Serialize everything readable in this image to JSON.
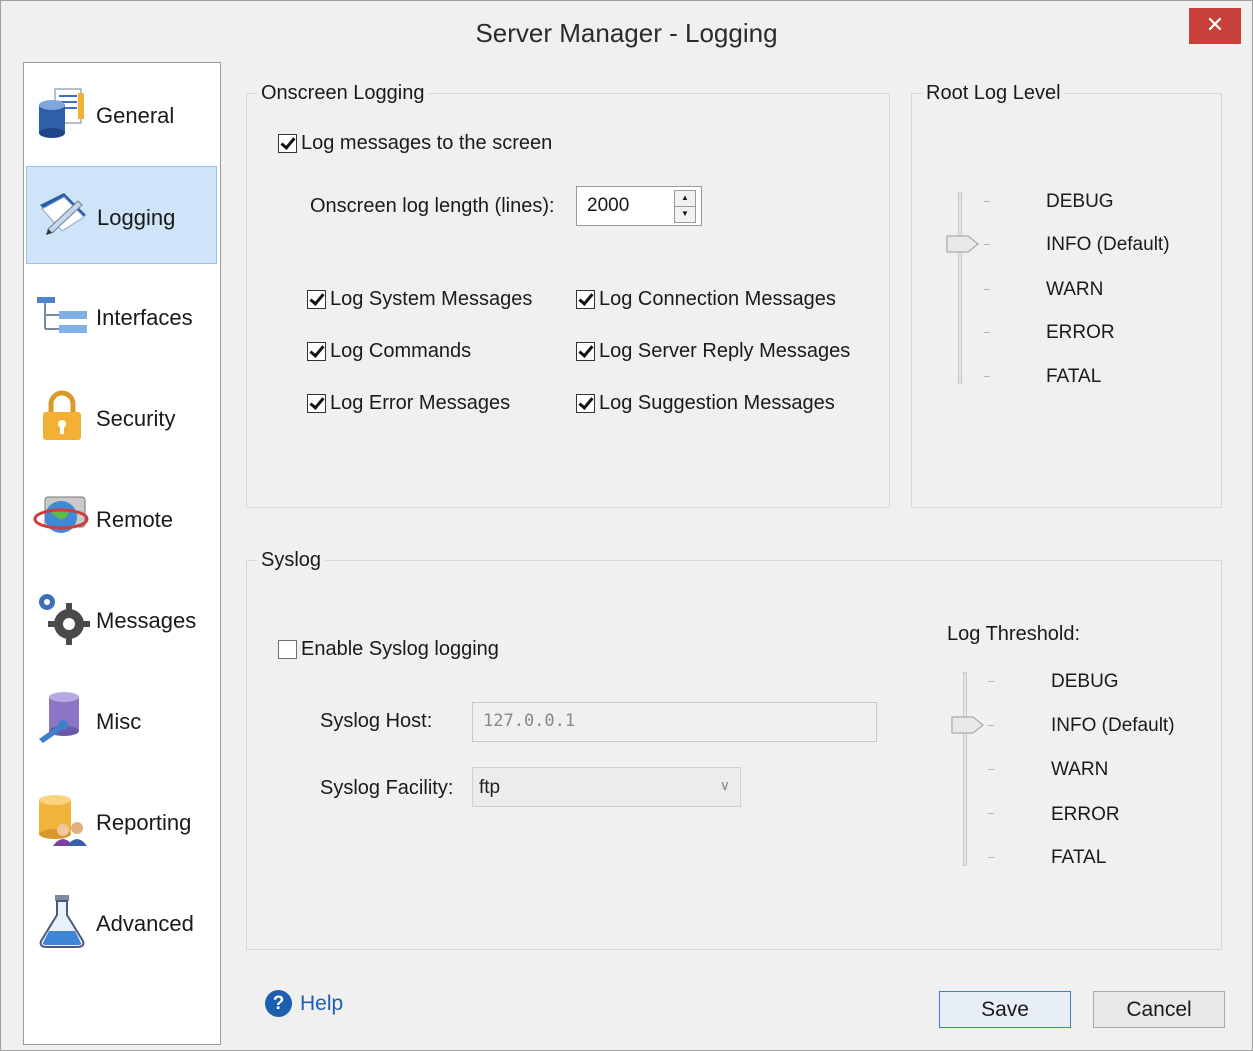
{
  "window": {
    "title": "Server Manager - Logging",
    "close_glyph": "✕"
  },
  "sidebar": {
    "items": [
      {
        "label": "General",
        "icon": "database-document-icon",
        "selected": false
      },
      {
        "label": "Logging",
        "icon": "logbook-pen-icon",
        "selected": true
      },
      {
        "label": "Interfaces",
        "icon": "network-tree-icon",
        "selected": false
      },
      {
        "label": "Security",
        "icon": "padlock-icon",
        "selected": false
      },
      {
        "label": "Remote",
        "icon": "globe-monitor-icon",
        "selected": false
      },
      {
        "label": "Messages",
        "icon": "gears-icon",
        "selected": false
      },
      {
        "label": "Misc",
        "icon": "database-wrench-icon",
        "selected": false
      },
      {
        "label": "Reporting",
        "icon": "database-users-icon",
        "selected": false
      },
      {
        "label": "Advanced",
        "icon": "flask-icon",
        "selected": false
      }
    ]
  },
  "onscreen": {
    "legend": "Onscreen Logging",
    "log_to_screen": {
      "label": "Log messages to the screen",
      "checked": true
    },
    "length_label": "Onscreen log length (lines):",
    "length_value": "2000",
    "options": [
      {
        "label": "Log System Messages",
        "checked": true
      },
      {
        "label": "Log Connection Messages",
        "checked": true
      },
      {
        "label": "Log Commands",
        "checked": true
      },
      {
        "label": "Log Server Reply Messages",
        "checked": true
      },
      {
        "label": "Log Error Messages",
        "checked": true
      },
      {
        "label": "Log Suggestion Messages",
        "checked": true
      }
    ]
  },
  "root_log": {
    "legend": "Root Log Level",
    "levels": [
      "DEBUG",
      "INFO (Default)",
      "WARN",
      "ERROR",
      "FATAL"
    ],
    "selected": "INFO (Default)"
  },
  "syslog": {
    "legend": "Syslog",
    "enable": {
      "label": "Enable Syslog logging",
      "checked": false
    },
    "host_label": "Syslog Host:",
    "host_value": "127.0.0.1",
    "facility_label": "Syslog Facility:",
    "facility_value": "ftp",
    "threshold_label": "Log Threshold:",
    "levels": [
      "DEBUG",
      "INFO (Default)",
      "WARN",
      "ERROR",
      "FATAL"
    ],
    "selected": "INFO (Default)"
  },
  "footer": {
    "help_label": "Help",
    "save_label": "Save",
    "cancel_label": "Cancel"
  },
  "colors": {
    "accent": "#1c5fb0",
    "close": "#c7403a",
    "selection": "#cfe4f8"
  }
}
